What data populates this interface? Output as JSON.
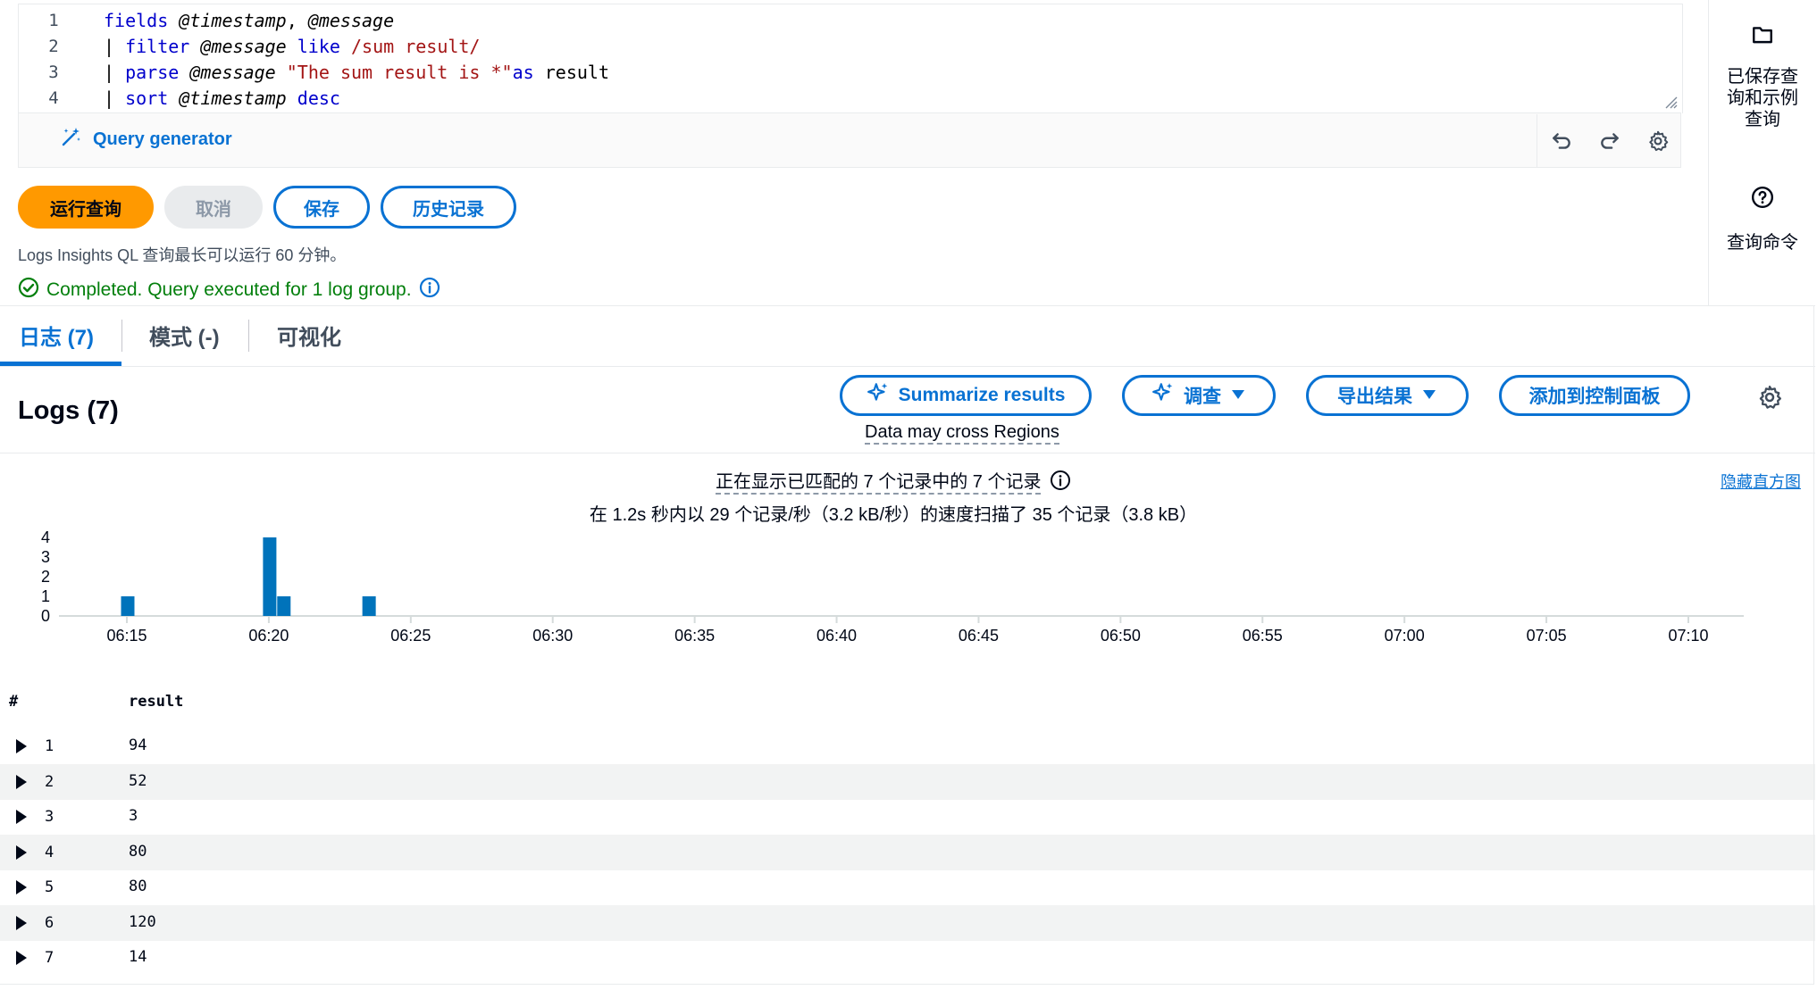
{
  "editor": {
    "lines": [
      {
        "num": "1",
        "tokens": [
          [
            "kw",
            "fields"
          ],
          [
            "plain",
            " "
          ],
          [
            "at",
            "@timestamp"
          ],
          [
            "plain",
            ", "
          ],
          [
            "at",
            "@message"
          ]
        ]
      },
      {
        "num": "2",
        "tokens": [
          [
            "pipe",
            "| "
          ],
          [
            "kw",
            "filter"
          ],
          [
            "plain",
            " "
          ],
          [
            "at",
            "@message"
          ],
          [
            "plain",
            " "
          ],
          [
            "kw",
            "like"
          ],
          [
            "plain",
            " "
          ],
          [
            "str",
            "/sum result/"
          ]
        ]
      },
      {
        "num": "3",
        "tokens": [
          [
            "pipe",
            "| "
          ],
          [
            "kw",
            "parse"
          ],
          [
            "plain",
            " "
          ],
          [
            "at",
            "@message"
          ],
          [
            "plain",
            " "
          ],
          [
            "str",
            "\"The sum result is *\""
          ],
          [
            "kw",
            "as"
          ],
          [
            "plain",
            " result"
          ]
        ]
      },
      {
        "num": "4",
        "tokens": [
          [
            "pipe",
            "| "
          ],
          [
            "kw",
            "sort"
          ],
          [
            "plain",
            " "
          ],
          [
            "at",
            "@timestamp"
          ],
          [
            "plain",
            " "
          ],
          [
            "kw",
            "desc"
          ]
        ]
      }
    ]
  },
  "query_generator": {
    "label": "Query generator"
  },
  "toolbar": {
    "run_label": "运行查询",
    "cancel_label": "取消",
    "save_label": "保存",
    "history_label": "历史记录"
  },
  "limit_text": "Logs Insights QL 查询最长可以运行 60 分钟。",
  "status_text": "Completed. Query executed for 1 log group.",
  "side_panel": {
    "saved_queries": "已保存查询和示例查询",
    "query_commands": "查询命令"
  },
  "tabs": [
    {
      "label": "日志 (7)"
    },
    {
      "label": "模式 (-)"
    },
    {
      "label": "可视化"
    }
  ],
  "logs_header": {
    "title": "Logs (7)",
    "summarize_label": "Summarize results",
    "investigate_label": "调查",
    "export_label": "导出结果",
    "add_dashboard_label": "添加到控制面板",
    "cross_regions": "Data may cross Regions"
  },
  "histogram_info": {
    "matched_text": "正在显示已匹配的 7 个记录中的 7 个记录",
    "scan_text": "在 1.2s 秒内以 29 个记录/秒（3.2 kB/秒）的速度扫描了 35 个记录（3.8 kB）",
    "hide_label": "隐藏直方图"
  },
  "chart_data": {
    "type": "bar",
    "x_ticks": [
      "06:15",
      "06:20",
      "06:25",
      "06:30",
      "06:35",
      "06:40",
      "06:45",
      "06:50",
      "06:55",
      "07:00",
      "07:05",
      "07:10"
    ],
    "y_ticks": [
      "4",
      "3",
      "2",
      "1",
      "0"
    ],
    "ylim": [
      0,
      4
    ],
    "bars": [
      {
        "time": "06:15",
        "value": 1
      },
      {
        "time": "06:20",
        "value": 4
      },
      {
        "time": "06:20:30",
        "value": 1
      },
      {
        "time": "06:23:30",
        "value": 1
      }
    ],
    "bar_color": "#0073bb"
  },
  "table": {
    "headers": {
      "index": "#",
      "result": "result"
    },
    "rows": [
      {
        "num": "1",
        "result": "94"
      },
      {
        "num": "2",
        "result": "52"
      },
      {
        "num": "3",
        "result": "3"
      },
      {
        "num": "4",
        "result": "80"
      },
      {
        "num": "5",
        "result": "80"
      },
      {
        "num": "6",
        "result": "120"
      },
      {
        "num": "7",
        "result": "14"
      }
    ]
  }
}
